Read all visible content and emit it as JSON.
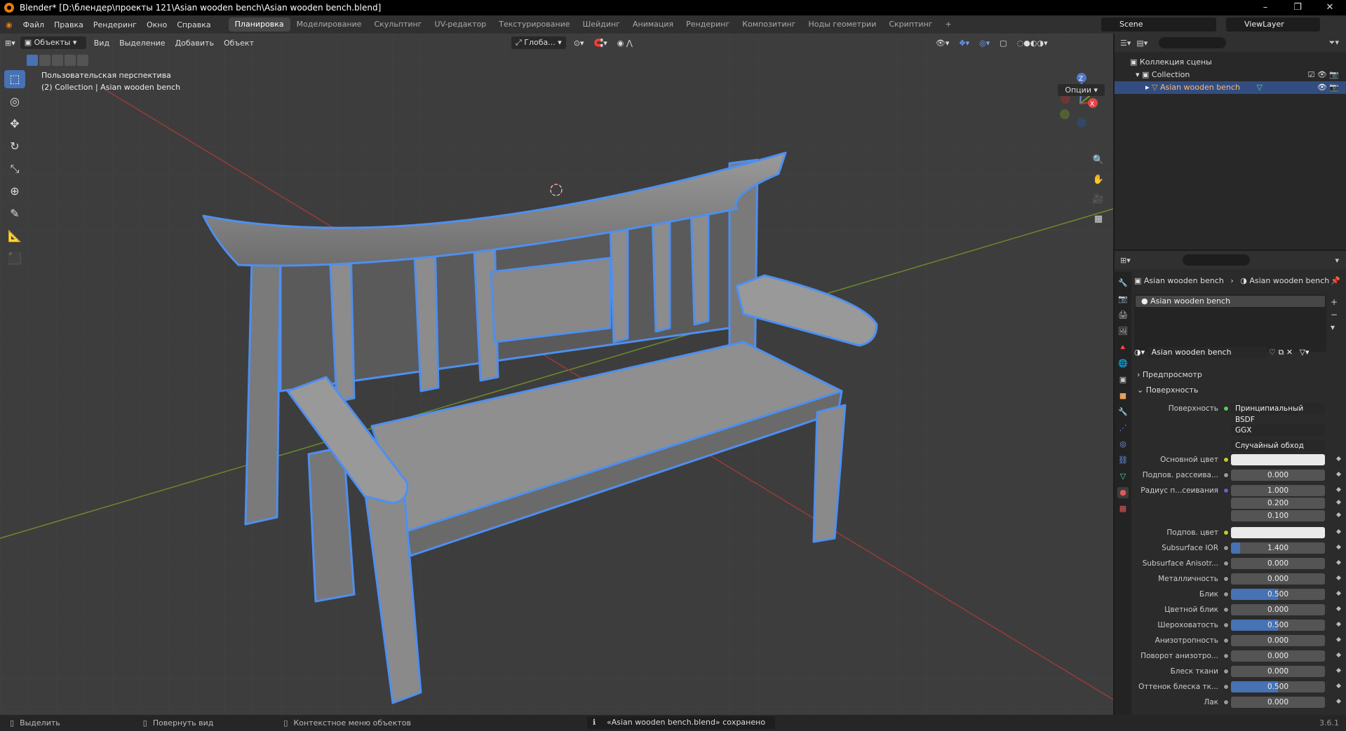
{
  "window": {
    "title": "Blender* [D:\\блендер\\проекты 121\\Asian wooden bench\\Asian wooden bench.blend]",
    "controls": [
      "–",
      "❐",
      "✕"
    ]
  },
  "menu": {
    "items": [
      "Файл",
      "Правка",
      "Рендеринг",
      "Окно",
      "Справка"
    ],
    "workspaces": [
      "Планировка",
      "Моделирование",
      "Скульптинг",
      "UV-редактор",
      "Текстурирование",
      "Шейдинг",
      "Анимация",
      "Рендеринг",
      "Композитинг",
      "Ноды геометрии",
      "Скриптинг"
    ],
    "active_workspace": "Планировка",
    "add_tab": "+",
    "scene": "Scene",
    "view_layer": "ViewLayer"
  },
  "viewport": {
    "mode": "Объекты",
    "menus": [
      "Вид",
      "Выделение",
      "Добавить",
      "Объект"
    ],
    "orientation": "Глоба...",
    "options": "Опции",
    "view_name": "Пользовательская перспектива",
    "collection_info": "(2) Collection | Asian wooden bench",
    "gizmo_labels": [
      "Z",
      "Y",
      "X"
    ]
  },
  "outliner": {
    "rows": [
      {
        "label": "Коллекция сцены",
        "level": 0
      },
      {
        "label": "Collection",
        "level": 1
      },
      {
        "label": "Asian wooden bench",
        "level": 2,
        "selected": true
      }
    ]
  },
  "properties": {
    "breadcrumb": [
      "Asian wooden bench",
      "Asian wooden bench"
    ],
    "material_slot": "Asian wooden bench",
    "material_name": "Asian wooden bench",
    "sections": {
      "preview": "Предпросмотр",
      "surface": "Поверхность"
    },
    "surface_label": "Поверхность",
    "surface_value": "Принципиальный BSDF",
    "distribution": "GGX",
    "subsurface_method": "Случайный обход",
    "rows": [
      {
        "label": "Основной цвет",
        "value": "",
        "type": "color",
        "dot": "yellow"
      },
      {
        "label": "Подпов. рассеива...",
        "value": "0.000",
        "type": "num",
        "dot": "gray"
      },
      {
        "label": "Радиус п...сеивания",
        "value": "1.000",
        "type": "num",
        "dot": "blue"
      },
      {
        "label": "",
        "value": "0.200",
        "type": "num",
        "dot": ""
      },
      {
        "label": "",
        "value": "0.100",
        "type": "num",
        "dot": ""
      },
      {
        "label": "Подпов. цвет",
        "value": "",
        "type": "color",
        "dot": "yellow"
      },
      {
        "label": "Subsurface IOR",
        "value": "1.400",
        "type": "num",
        "dot": "gray",
        "fill": 0.1
      },
      {
        "label": "Subsurface Anisotr...",
        "value": "0.000",
        "type": "num",
        "dot": "gray"
      },
      {
        "label": "Металличность",
        "value": "0.000",
        "type": "num",
        "dot": "gray"
      },
      {
        "label": "Блик",
        "value": "0.500",
        "type": "num",
        "dot": "gray",
        "fill": 0.5
      },
      {
        "label": "Цветной блик",
        "value": "0.000",
        "type": "num",
        "dot": "gray"
      },
      {
        "label": "Шероховатость",
        "value": "0.500",
        "type": "num",
        "dot": "gray",
        "fill": 0.5
      },
      {
        "label": "Анизотропность",
        "value": "0.000",
        "type": "num",
        "dot": "gray"
      },
      {
        "label": "Поворот анизотро...",
        "value": "0.000",
        "type": "num",
        "dot": "gray"
      },
      {
        "label": "Блеск ткани",
        "value": "0.000",
        "type": "num",
        "dot": "gray"
      },
      {
        "label": "Оттенок блеска тк...",
        "value": "0.500",
        "type": "num",
        "dot": "gray",
        "fill": 0.5
      },
      {
        "label": "Лак",
        "value": "0.000",
        "type": "num",
        "dot": "gray"
      }
    ]
  },
  "status": {
    "select": "Выделить",
    "rotate": "Повернуть вид",
    "context": "Контекстное меню объектов",
    "message": "«Asian wooden bench.blend» сохранено",
    "version": "3.6.1"
  },
  "colors": {
    "accent": "#4772b3",
    "selection_outline": "#4e8ff0",
    "bg": "#3d3d3d"
  }
}
